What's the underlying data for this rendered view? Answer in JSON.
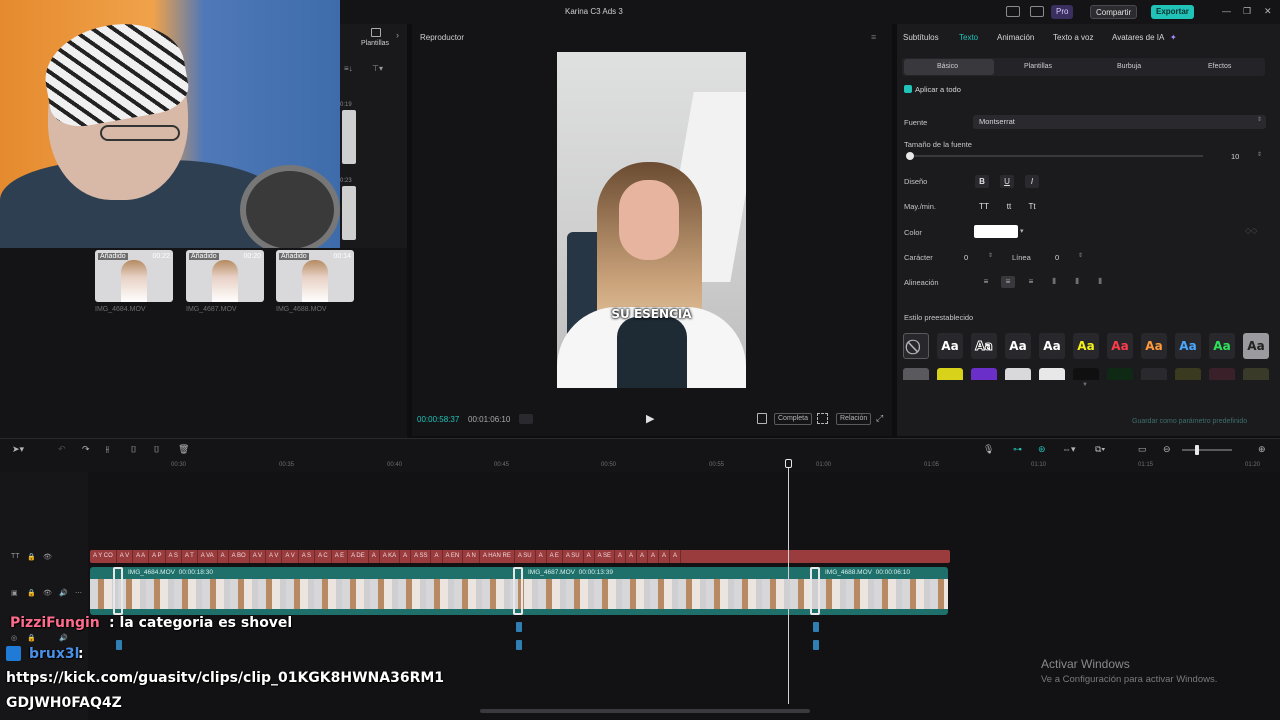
{
  "titlebar": {
    "app_title": "Karina C3 Ads 3",
    "pro_label": "Pro",
    "share_label": "Compartir",
    "export_label": "Exportar"
  },
  "media": {
    "strip_times": [
      "0:19",
      "0:23"
    ],
    "strip_tabs": [
      "Plantillas"
    ],
    "clips": [
      {
        "tag": "Añadido",
        "duration": "00:22",
        "name": "IMG_4684.MOV"
      },
      {
        "tag": "Añadido",
        "duration": "00:20",
        "name": "IMG_4687.MOV"
      },
      {
        "tag": "Añadido",
        "duration": "00:14",
        "name": "IMG_4688.MOV"
      }
    ]
  },
  "player": {
    "title": "Reproductor",
    "caption": "SU ESENCIA",
    "time_current": "00:00:58:37",
    "time_total": "00:01:06:10",
    "full_label": "Completa",
    "ratio_label": "Relación"
  },
  "props": {
    "tabs": [
      "Subtítulos",
      "Texto",
      "Animación",
      "Texto a voz",
      "Avatares de IA"
    ],
    "active_tab": "Texto",
    "subtabs": [
      "Básico",
      "Plantillas",
      "Burbuja",
      "Efectos"
    ],
    "apply_all": "Aplicar a todo",
    "font_label": "Fuente",
    "font_value": "Montserrat",
    "size_label": "Tamaño de la fuente",
    "size_value": "10",
    "design_label": "Diseño",
    "design_buttons": [
      "B",
      "U",
      "I"
    ],
    "case_label": "May./min.",
    "case_buttons": [
      "TT",
      "tt",
      "Tt"
    ],
    "color_label": "Color",
    "color_value": "#ffffff",
    "char_label": "Carácter",
    "char_value": "0",
    "line_label": "Línea",
    "line_value": "0",
    "align_label": "Alineación",
    "preset_label": "Estilo preestablecido",
    "preset_sample": "Aa",
    "preset_colors": [
      "#ffffff",
      "#ffffff",
      "#ffffff",
      "#ffffff",
      "#f2f21a",
      "#ff3b4a",
      "#ff9a3c",
      "#4aa8ff",
      "#2ee35a",
      "#e8e8e8"
    ],
    "save_default": "Guardar como parámetro predefinido"
  },
  "timeline": {
    "ticks": [
      "00:30",
      "00:35",
      "00:40",
      "00:45",
      "00:50",
      "00:55",
      "01:00",
      "01:05",
      "01:10",
      "01:15",
      "01:20"
    ],
    "text_segments": [
      "A Y CO",
      "A V",
      "A A",
      "A P",
      "A S",
      "A T",
      "A VA",
      "A",
      "A BO",
      "A V",
      "A V",
      "A V",
      "A S",
      "A C",
      "A E",
      "A DE",
      "A",
      "A KA",
      "A",
      "A SS",
      "A",
      "A EN",
      "A N",
      "A HAN RE",
      "A SU",
      "A",
      "A E",
      "A SU",
      "A",
      "A SE",
      "A",
      "A",
      "A",
      "A",
      "A",
      "A"
    ],
    "clips": [
      {
        "name": "IMG_4684.MOV",
        "duration": "00:00:18:30"
      },
      {
        "name": "IMG_4687.MOV",
        "duration": "00:00:13:39"
      },
      {
        "name": "IMG_4688.MOV",
        "duration": "00:00:06:10"
      }
    ]
  },
  "chat": {
    "user1": "PizziFungin",
    "msg1": ": la categoria es shovel",
    "user2": "brux3l",
    "colon2": ":",
    "url_line1": "https://kick.com/guasitv/clips/clip_01KGK8HWNA36RM1",
    "url_line2": "GDJWH0FAQ4Z"
  },
  "windows": {
    "activate_title": "Activar Windows",
    "activate_sub": "Ve a Configuración para activar Windows."
  }
}
